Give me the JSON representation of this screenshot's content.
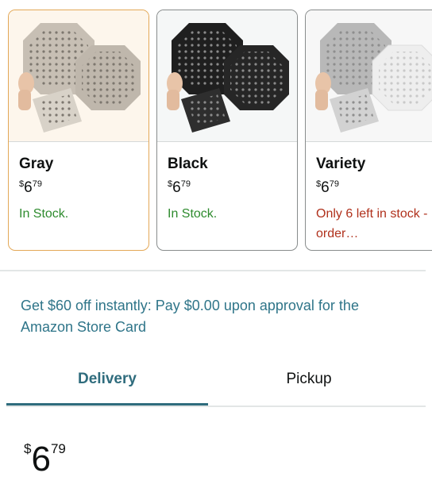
{
  "variants": [
    {
      "name": "Gray",
      "price_symbol": "$",
      "price_whole": "6",
      "price_fraction": "79",
      "stock": "In Stock.",
      "image_icon": "drain-cover-gray-icon"
    },
    {
      "name": "Black",
      "price_symbol": "$",
      "price_whole": "6",
      "price_fraction": "79",
      "stock": "In Stock.",
      "image_icon": "drain-cover-black-icon"
    },
    {
      "name": "Variety",
      "price_symbol": "$",
      "price_whole": "6",
      "price_fraction": "79",
      "stock": "Only 6 left in stock - order…",
      "image_icon": "drain-cover-variety-icon"
    }
  ],
  "promo": "Get $60 off instantly: Pay $0.00 upon approval for the Amazon Store Card",
  "tabs": {
    "delivery": "Delivery",
    "pickup": "Pickup"
  },
  "price": {
    "symbol": "$",
    "whole": "6",
    "fraction": "79"
  },
  "colors": {
    "accent": "#2f6c7d",
    "in_stock": "#2e8b2e",
    "low_stock": "#b0311c",
    "selected_border": "#e3a857"
  }
}
